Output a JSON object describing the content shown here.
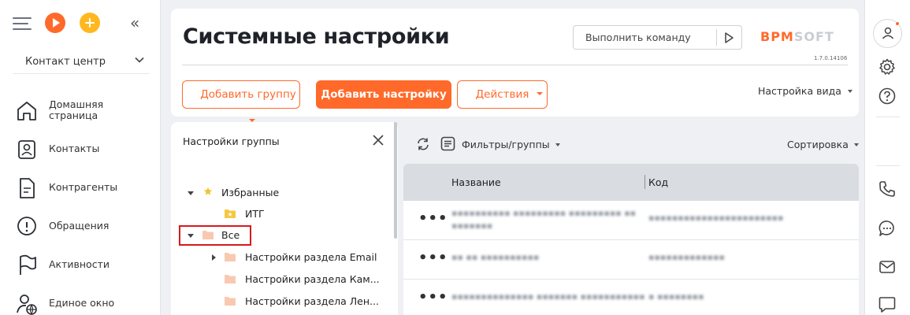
{
  "sidebar": {
    "workspace": "Контакт центр",
    "items": [
      {
        "id": "home",
        "label": "Домашняя страница"
      },
      {
        "id": "contacts",
        "label": "Контакты"
      },
      {
        "id": "accounts",
        "label": "Контрагенты"
      },
      {
        "id": "cases",
        "label": "Обращения"
      },
      {
        "id": "activities",
        "label": "Активности"
      },
      {
        "id": "single-window",
        "label": "Единое окно"
      }
    ]
  },
  "header": {
    "title": "Системные настройки",
    "command_placeholder": "Выполнить команду",
    "logo_part1": "BPM",
    "logo_part2": "SOFT",
    "version": "1.7.0.14106",
    "add_group_label": "Добавить группу",
    "add_setting_label": "Добавить настройку",
    "actions_label": "Действия",
    "view_settings_label": "Настройка вида"
  },
  "group_panel": {
    "title": "Настройки группы",
    "tree": [
      {
        "label": "Избранные"
      },
      {
        "label": "ИТГ"
      },
      {
        "label": "Все"
      },
      {
        "label": "Настройки раздела Email"
      },
      {
        "label": "Настройки раздела Кам..."
      },
      {
        "label": "Настройки раздела Лен..."
      }
    ]
  },
  "grid": {
    "filters_label": "Фильтры/группы",
    "sort_label": "Сортировка",
    "columns": [
      "Название",
      "Код"
    ],
    "row_menu": "•••"
  },
  "colors": {
    "accent": "#ff6a2b",
    "accent_yellow": "#ffb81f",
    "highlight": "#d7191c",
    "header_bg": "#d9dce1"
  }
}
